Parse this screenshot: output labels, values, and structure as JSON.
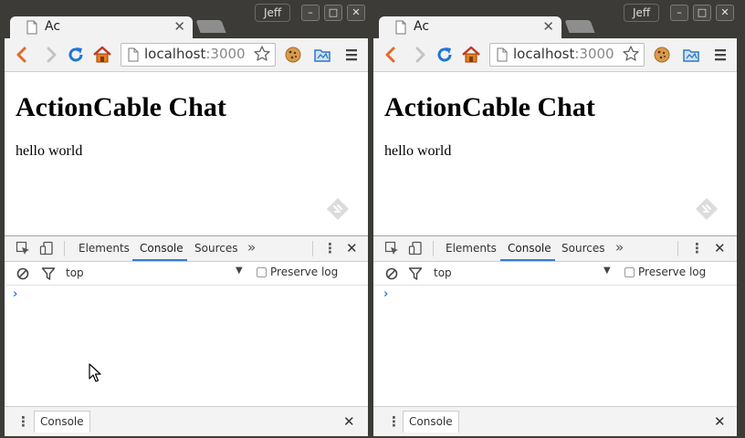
{
  "windows": [
    {
      "user": "Jeff",
      "tab_title": "Ac",
      "url_host": "localhost",
      "url_port": ":3000",
      "page": {
        "heading": "ActionCable Chat",
        "text": "hello world"
      },
      "devtools": {
        "tabs": [
          {
            "label": "Elements"
          },
          {
            "label": "Console"
          },
          {
            "label": "Sources"
          }
        ],
        "more": "»",
        "active_tab": "Console",
        "context": "top",
        "preserve_log": "Preserve log",
        "prompt": "›",
        "drawer_tab": "Console"
      }
    },
    {
      "user": "Jeff",
      "tab_title": "Ac",
      "url_host": "localhost",
      "url_port": ":3000",
      "page": {
        "heading": "ActionCable Chat",
        "text": "hello world"
      },
      "devtools": {
        "tabs": [
          {
            "label": "Elements"
          },
          {
            "label": "Console"
          },
          {
            "label": "Sources"
          }
        ],
        "more": "»",
        "active_tab": "Console",
        "context": "top",
        "preserve_log": "Preserve log",
        "prompt": "›",
        "drawer_tab": "Console"
      }
    }
  ],
  "colors": {
    "titlebar": "#3c3b37",
    "toolbar": "#f2f2f2",
    "devtools_accent": "#3879d9",
    "reload_blue": "#1f76d6",
    "back_orange": "#e06b2c"
  },
  "icons": {
    "window_controls": [
      "minimize-icon",
      "maximize-icon",
      "close-icon"
    ],
    "toolbar": [
      "back-icon",
      "forward-icon",
      "reload-icon",
      "home-icon",
      "page-icon",
      "star-icon",
      "cookie-icon",
      "folder-icon",
      "menu-icon"
    ],
    "devtools": [
      "inspect-icon",
      "device-icon",
      "clear-icon",
      "filter-icon",
      "kebab-icon",
      "close-icon"
    ]
  }
}
